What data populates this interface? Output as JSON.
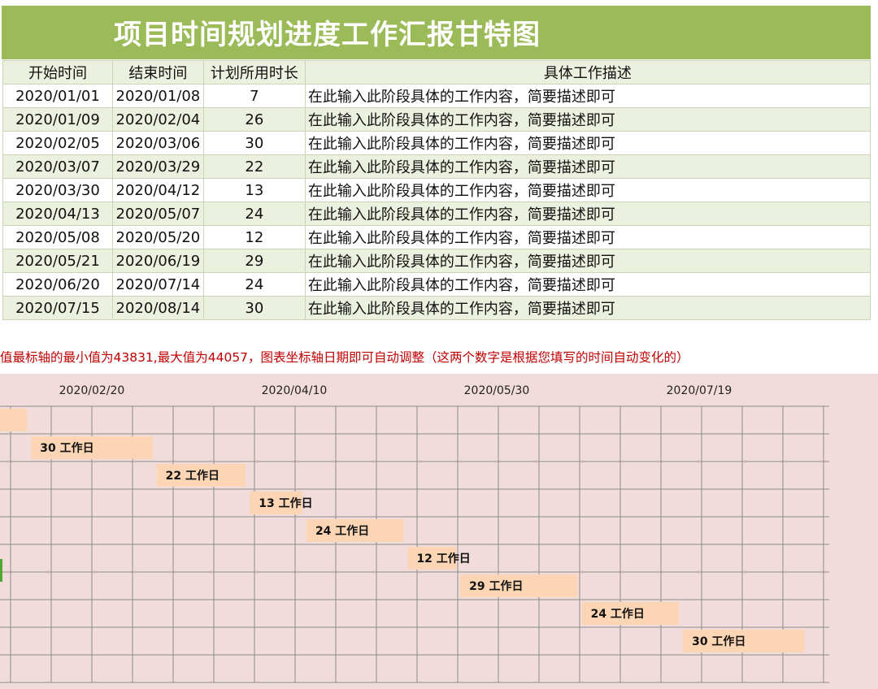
{
  "title": "项目时间规划进度工作汇报甘特图",
  "table": {
    "headers": [
      "开始时间",
      "结束时间",
      "计划所用时长",
      "具体工作描述"
    ],
    "rows": [
      {
        "start": "2020/01/01",
        "end": "2020/01/08",
        "days": "7",
        "desc": "在此输入此阶段具体的工作内容，简要描述即可"
      },
      {
        "start": "2020/01/09",
        "end": "2020/02/04",
        "days": "26",
        "desc": "在此输入此阶段具体的工作内容，简要描述即可"
      },
      {
        "start": "2020/02/05",
        "end": "2020/03/06",
        "days": "30",
        "desc": "在此输入此阶段具体的工作内容，简要描述即可"
      },
      {
        "start": "2020/03/07",
        "end": "2020/03/29",
        "days": "22",
        "desc": "在此输入此阶段具体的工作内容，简要描述即可"
      },
      {
        "start": "2020/03/30",
        "end": "2020/04/12",
        "days": "13",
        "desc": "在此输入此阶段具体的工作内容，简要描述即可"
      },
      {
        "start": "2020/04/13",
        "end": "2020/05/07",
        "days": "24",
        "desc": "在此输入此阶段具体的工作内容，简要描述即可"
      },
      {
        "start": "2020/05/08",
        "end": "2020/05/20",
        "days": "12",
        "desc": "在此输入此阶段具体的工作内容，简要描述即可"
      },
      {
        "start": "2020/05/21",
        "end": "2020/06/19",
        "days": "29",
        "desc": "在此输入此阶段具体的工作内容，简要描述即可"
      },
      {
        "start": "2020/06/20",
        "end": "2020/07/14",
        "days": "24",
        "desc": "在此输入此阶段具体的工作内容，简要描述即可"
      },
      {
        "start": "2020/07/15",
        "end": "2020/08/14",
        "days": "30",
        "desc": "在此输入此阶段具体的工作内容，简要描述即可"
      }
    ]
  },
  "note": "值最标轴的最小值为43831,最大值为44057，图表坐标轴日期即可自动调整（这两个数字是根据您填写的时间自动变化的）",
  "colors": {
    "title_bg": "#9bbb59",
    "row_alt": "#ebf1de",
    "chart_bg": "#f2dcdb",
    "bar": "#fcd5b4",
    "note": "#c00000"
  },
  "chart_data": {
    "type": "bar",
    "orientation": "horizontal-gantt",
    "x_ticks": [
      "2020/02/20",
      "2020/04/10",
      "2020/05/30",
      "2020/07/19"
    ],
    "bars": [
      {
        "start": "2020/01/09",
        "days": 26,
        "label": ""
      },
      {
        "start": "2020/02/05",
        "days": 30,
        "label": "30 工作日"
      },
      {
        "start": "2020/03/07",
        "days": 22,
        "label": "22 工作日"
      },
      {
        "start": "2020/03/30",
        "days": 13,
        "label": "13 工作日"
      },
      {
        "start": "2020/04/13",
        "days": 24,
        "label": "24 工作日"
      },
      {
        "start": "2020/05/08",
        "days": 12,
        "label": "12 工作日"
      },
      {
        "start": "2020/05/21",
        "days": 29,
        "label": "29 工作日"
      },
      {
        "start": "2020/06/20",
        "days": 24,
        "label": "24 工作日"
      },
      {
        "start": "2020/07/15",
        "days": 30,
        "label": "30 工作日"
      }
    ]
  }
}
